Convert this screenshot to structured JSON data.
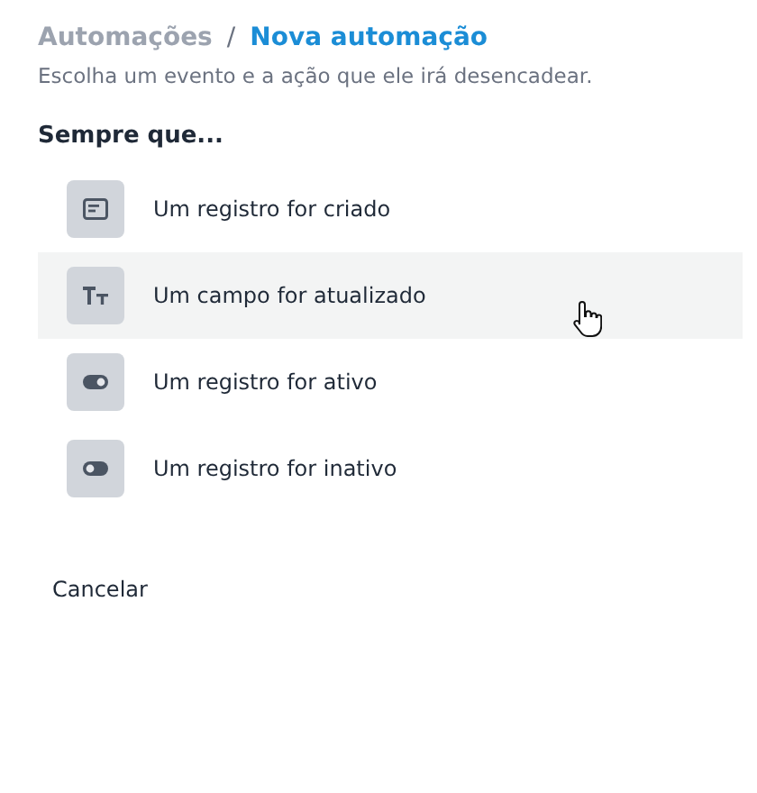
{
  "breadcrumb": {
    "parent": "Automações",
    "separator": "/",
    "current": "Nova automação"
  },
  "subtitle": "Escolha um evento e a ação que ele irá desencadear.",
  "section_title": "Sempre que...",
  "events": [
    {
      "label": "Um registro for criado",
      "kind": "record",
      "highlighted": false
    },
    {
      "label": "Um campo for atualizado",
      "kind": "text",
      "highlighted": true
    },
    {
      "label": "Um registro for ativo",
      "kind": "toggle-on",
      "highlighted": false
    },
    {
      "label": "Um registro for inativo",
      "kind": "toggle-off",
      "highlighted": false
    }
  ],
  "cancel_button": "Cancelar"
}
